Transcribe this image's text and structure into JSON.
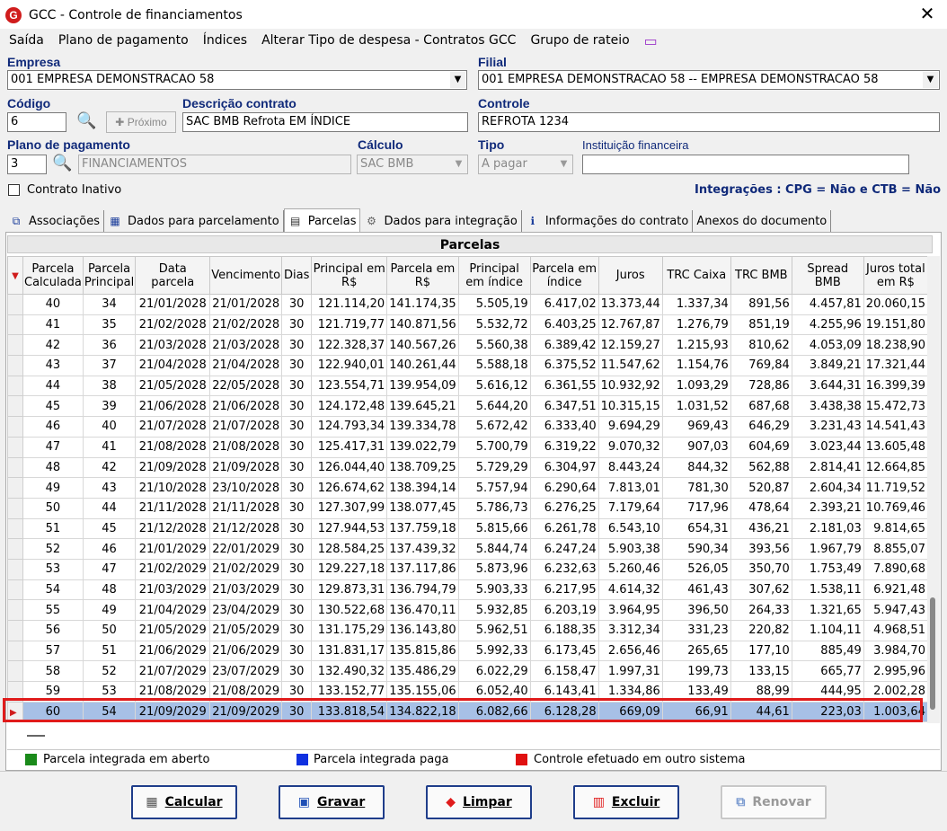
{
  "window": {
    "title": "GCC - Controle de financiamentos"
  },
  "menu": [
    "Saída",
    "Plano de pagamento",
    "Índices",
    "Alterar Tipo de despesa - Contratos GCC",
    "Grupo de rateio"
  ],
  "form": {
    "empresa_label": "Empresa",
    "empresa_value": "001 EMPRESA DEMONSTRACAO 58",
    "filial_label": "Filial",
    "filial_value": "001 EMPRESA DEMONSTRACAO 58 -- EMPRESA DEMONSTRACAO 58",
    "codigo_label": "Código",
    "codigo_value": "6",
    "proximo_label": "Próximo",
    "descricao_label": "Descrição contrato",
    "descricao_value": "SAC BMB Refrota EM ÍNDICE",
    "controle_label": "Controle",
    "controle_value": "REFROTA 1234",
    "plano_label": "Plano de pagamento",
    "plano_code": "3",
    "plano_value": "FINANCIAMENTOS",
    "calculo_label": "Cálculo",
    "calculo_value": "SAC BMB",
    "tipo_label": "Tipo",
    "tipo_value": "A pagar",
    "instituicao_label": "Instituição financeira",
    "instituicao_value": "",
    "inativo_label": "Contrato Inativo",
    "integracoes": "Integrações : CPG = Não e CTB = Não"
  },
  "tabs": [
    "Associações",
    "Dados para parcelamento",
    "Parcelas",
    "Dados para integração",
    "Informações do contrato",
    "Anexos do documento"
  ],
  "grid": {
    "title": "Parcelas",
    "headers": [
      "Parcela Calculada",
      "Parcela Principal",
      "Data parcela",
      "Vencimento",
      "Dias",
      "Principal em R$",
      "Parcela em R$",
      "Principal em índice",
      "Parcela em índice",
      "Juros",
      "TRC Caixa",
      "TRC BMB",
      "Spread BMB",
      "Juros total em R$"
    ],
    "rows": [
      [
        "40",
        "34",
        "21/01/2028",
        "21/01/2028",
        "30",
        "121.114,20",
        "141.174,35",
        "5.505,19",
        "6.417,02",
        "13.373,44",
        "1.337,34",
        "891,56",
        "4.457,81",
        "20.060,15"
      ],
      [
        "41",
        "35",
        "21/02/2028",
        "21/02/2028",
        "30",
        "121.719,77",
        "140.871,56",
        "5.532,72",
        "6.403,25",
        "12.767,87",
        "1.276,79",
        "851,19",
        "4.255,96",
        "19.151,80"
      ],
      [
        "42",
        "36",
        "21/03/2028",
        "21/03/2028",
        "30",
        "122.328,37",
        "140.567,26",
        "5.560,38",
        "6.389,42",
        "12.159,27",
        "1.215,93",
        "810,62",
        "4.053,09",
        "18.238,90"
      ],
      [
        "43",
        "37",
        "21/04/2028",
        "21/04/2028",
        "30",
        "122.940,01",
        "140.261,44",
        "5.588,18",
        "6.375,52",
        "11.547,62",
        "1.154,76",
        "769,84",
        "3.849,21",
        "17.321,44"
      ],
      [
        "44",
        "38",
        "21/05/2028",
        "22/05/2028",
        "30",
        "123.554,71",
        "139.954,09",
        "5.616,12",
        "6.361,55",
        "10.932,92",
        "1.093,29",
        "728,86",
        "3.644,31",
        "16.399,39"
      ],
      [
        "45",
        "39",
        "21/06/2028",
        "21/06/2028",
        "30",
        "124.172,48",
        "139.645,21",
        "5.644,20",
        "6.347,51",
        "10.315,15",
        "1.031,52",
        "687,68",
        "3.438,38",
        "15.472,73"
      ],
      [
        "46",
        "40",
        "21/07/2028",
        "21/07/2028",
        "30",
        "124.793,34",
        "139.334,78",
        "5.672,42",
        "6.333,40",
        "9.694,29",
        "969,43",
        "646,29",
        "3.231,43",
        "14.541,43"
      ],
      [
        "47",
        "41",
        "21/08/2028",
        "21/08/2028",
        "30",
        "125.417,31",
        "139.022,79",
        "5.700,79",
        "6.319,22",
        "9.070,32",
        "907,03",
        "604,69",
        "3.023,44",
        "13.605,48"
      ],
      [
        "48",
        "42",
        "21/09/2028",
        "21/09/2028",
        "30",
        "126.044,40",
        "138.709,25",
        "5.729,29",
        "6.304,97",
        "8.443,24",
        "844,32",
        "562,88",
        "2.814,41",
        "12.664,85"
      ],
      [
        "49",
        "43",
        "21/10/2028",
        "23/10/2028",
        "30",
        "126.674,62",
        "138.394,14",
        "5.757,94",
        "6.290,64",
        "7.813,01",
        "781,30",
        "520,87",
        "2.604,34",
        "11.719,52"
      ],
      [
        "50",
        "44",
        "21/11/2028",
        "21/11/2028",
        "30",
        "127.307,99",
        "138.077,45",
        "5.786,73",
        "6.276,25",
        "7.179,64",
        "717,96",
        "478,64",
        "2.393,21",
        "10.769,46"
      ],
      [
        "51",
        "45",
        "21/12/2028",
        "21/12/2028",
        "30",
        "127.944,53",
        "137.759,18",
        "5.815,66",
        "6.261,78",
        "6.543,10",
        "654,31",
        "436,21",
        "2.181,03",
        "9.814,65"
      ],
      [
        "52",
        "46",
        "21/01/2029",
        "22/01/2029",
        "30",
        "128.584,25",
        "137.439,32",
        "5.844,74",
        "6.247,24",
        "5.903,38",
        "590,34",
        "393,56",
        "1.967,79",
        "8.855,07"
      ],
      [
        "53",
        "47",
        "21/02/2029",
        "21/02/2029",
        "30",
        "129.227,18",
        "137.117,86",
        "5.873,96",
        "6.232,63",
        "5.260,46",
        "526,05",
        "350,70",
        "1.753,49",
        "7.890,68"
      ],
      [
        "54",
        "48",
        "21/03/2029",
        "21/03/2029",
        "30",
        "129.873,31",
        "136.794,79",
        "5.903,33",
        "6.217,95",
        "4.614,32",
        "461,43",
        "307,62",
        "1.538,11",
        "6.921,48"
      ],
      [
        "55",
        "49",
        "21/04/2029",
        "23/04/2029",
        "30",
        "130.522,68",
        "136.470,11",
        "5.932,85",
        "6.203,19",
        "3.964,95",
        "396,50",
        "264,33",
        "1.321,65",
        "5.947,43"
      ],
      [
        "56",
        "50",
        "21/05/2029",
        "21/05/2029",
        "30",
        "131.175,29",
        "136.143,80",
        "5.962,51",
        "6.188,35",
        "3.312,34",
        "331,23",
        "220,82",
        "1.104,11",
        "4.968,51"
      ],
      [
        "57",
        "51",
        "21/06/2029",
        "21/06/2029",
        "30",
        "131.831,17",
        "135.815,86",
        "5.992,33",
        "6.173,45",
        "2.656,46",
        "265,65",
        "177,10",
        "885,49",
        "3.984,70"
      ],
      [
        "58",
        "52",
        "21/07/2029",
        "23/07/2029",
        "30",
        "132.490,32",
        "135.486,29",
        "6.022,29",
        "6.158,47",
        "1.997,31",
        "199,73",
        "133,15",
        "665,77",
        "2.995,96"
      ],
      [
        "59",
        "53",
        "21/08/2029",
        "21/08/2029",
        "30",
        "133.152,77",
        "135.155,06",
        "6.052,40",
        "6.143,41",
        "1.334,86",
        "133,49",
        "88,99",
        "444,95",
        "2.002,28"
      ],
      [
        "60",
        "54",
        "21/09/2029",
        "21/09/2029",
        "30",
        "133.818,54",
        "134.822,18",
        "6.082,66",
        "6.128,28",
        "669,09",
        "66,91",
        "44,61",
        "223,03",
        "1.003,64"
      ]
    ]
  },
  "legend": {
    "green_label": "Parcela integrada em aberto",
    "blue_label": "Parcela integrada paga",
    "red_label": "Controle efetuado em outro sistema",
    "green": "#1a8a1a",
    "blue": "#1030e0",
    "red": "#e01010"
  },
  "buttons": {
    "calcular": "Calcular",
    "gravar": "Gravar",
    "limpar": "Limpar",
    "excluir": "Excluir",
    "renovar": "Renovar"
  }
}
